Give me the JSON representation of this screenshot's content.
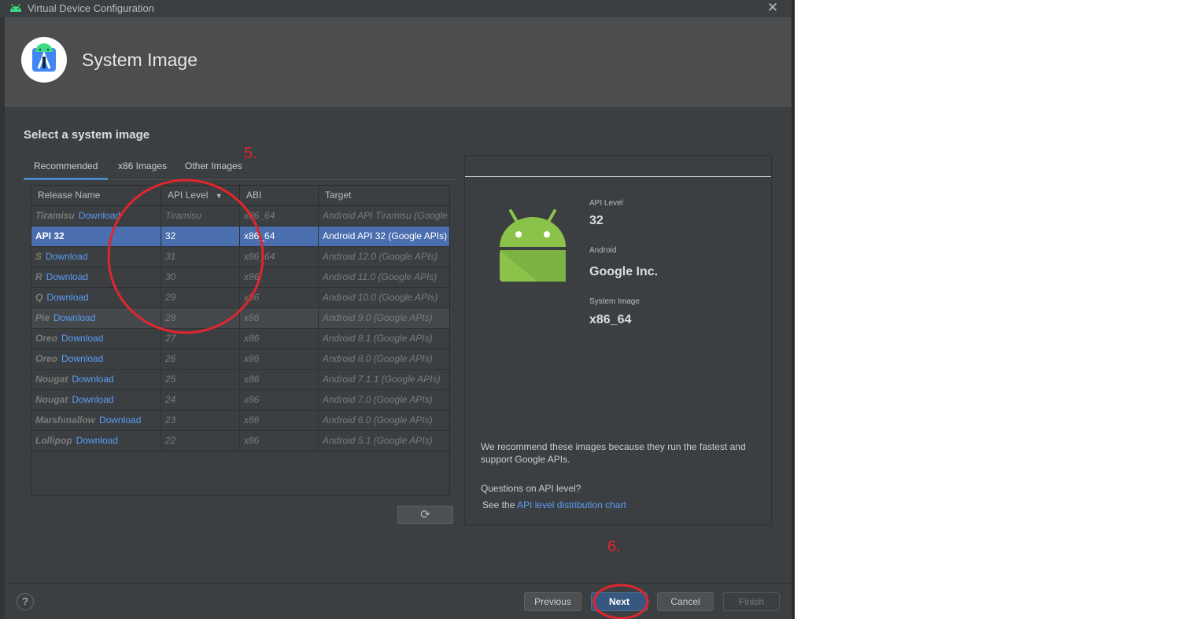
{
  "window": {
    "title": "Virtual Device Configuration"
  },
  "header": {
    "title": "System Image"
  },
  "section_title": "Select a system image",
  "tabs": [
    "Recommended",
    "x86 Images",
    "Other Images"
  ],
  "table": {
    "columns": [
      "Release Name",
      "API Level",
      "ABI",
      "Target"
    ],
    "rows": [
      {
        "name": "Tiramisu",
        "download": "Download",
        "api": "Tiramisu",
        "abi": "x86_64",
        "target": "Android API Tiramisu (Google APIs)"
      },
      {
        "name": "API 32",
        "download": "",
        "api": "32",
        "abi": "x86_64",
        "target": "Android API 32 (Google APIs)"
      },
      {
        "name": "S",
        "download": "Download",
        "api": "31",
        "abi": "x86_64",
        "target": "Android 12.0 (Google APIs)"
      },
      {
        "name": "R",
        "download": "Download",
        "api": "30",
        "abi": "x86",
        "target": "Android 11.0 (Google APIs)"
      },
      {
        "name": "Q",
        "download": "Download",
        "api": "29",
        "abi": "x86",
        "target": "Android 10.0 (Google APIs)"
      },
      {
        "name": "Pie",
        "download": "Download",
        "api": "28",
        "abi": "x86",
        "target": "Android 9.0 (Google APIs)"
      },
      {
        "name": "Oreo",
        "download": "Download",
        "api": "27",
        "abi": "x86",
        "target": "Android 8.1 (Google APIs)"
      },
      {
        "name": "Oreo",
        "download": "Download",
        "api": "26",
        "abi": "x86",
        "target": "Android 8.0 (Google APIs)"
      },
      {
        "name": "Nougat",
        "download": "Download",
        "api": "25",
        "abi": "x86",
        "target": "Android 7.1.1 (Google APIs)"
      },
      {
        "name": "Nougat",
        "download": "Download",
        "api": "24",
        "abi": "x86",
        "target": "Android 7.0 (Google APIs)"
      },
      {
        "name": "Marshmallow",
        "download": "Download",
        "api": "23",
        "abi": "x86",
        "target": "Android 6.0 (Google APIs)"
      },
      {
        "name": "Lollipop",
        "download": "Download",
        "api": "22",
        "abi": "x86",
        "target": "Android 5.1 (Google APIs)"
      }
    ],
    "selected_index": 1,
    "hover_index": 5
  },
  "refresh_icon": "refresh-icon",
  "details": {
    "api_level_label": "API Level",
    "api_level_value": "32",
    "android_label": "Android",
    "android_value": "Google Inc.",
    "system_image_label": "System Image",
    "system_image_value": "x86_64",
    "recommend_text_1": "We recommend these images because they run the fastest and",
    "recommend_text_2": "support Google APIs.",
    "questions": "Questions on API level?",
    "see_the": "See the",
    "link_text": "API level distribution chart"
  },
  "buttons": {
    "help": "?",
    "previous": "Previous",
    "next": "Next",
    "cancel": "Cancel",
    "finish": "Finish"
  },
  "annotations": {
    "step5": "5.",
    "step6": "6."
  },
  "colors": {
    "accent": "#4a88c7",
    "selection": "#4b6eaf",
    "link": "#589df6",
    "annotation": "#e0262d",
    "android_green": "#8bc34a"
  }
}
